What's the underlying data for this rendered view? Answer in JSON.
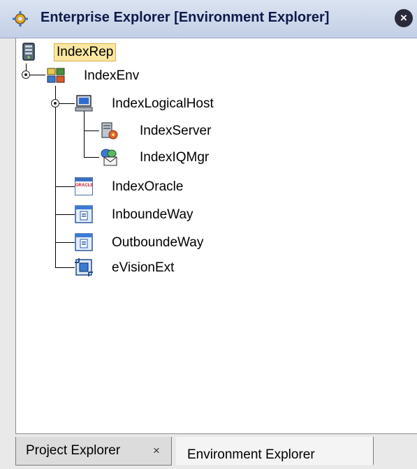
{
  "window": {
    "title": "Enterprise Explorer [Environment Explorer]",
    "icon": "explorer-gear-icon",
    "close_icon": "close-icon",
    "close_glyph": "×"
  },
  "tree": {
    "root": {
      "label": "IndexRep",
      "icon": "repository-icon",
      "selected": true
    },
    "environment": {
      "label": "IndexEnv",
      "icon": "environment-icon"
    },
    "logical_host": {
      "label": "IndexLogicalHost",
      "icon": "computer-host-icon"
    },
    "server": {
      "label": "IndexServer",
      "icon": "server-icon"
    },
    "iq_manager": {
      "label": "IndexIQMgr",
      "icon": "message-queue-icon"
    },
    "oracle": {
      "label": "IndexOracle",
      "icon": "oracle-icon",
      "icon_text": "ORACLE"
    },
    "inbound": {
      "label": "InboundeWay",
      "icon": "eway-icon"
    },
    "outbound": {
      "label": "OutboundeWay",
      "icon": "eway-icon"
    },
    "evision": {
      "label": "eVisionExt",
      "icon": "evision-icon"
    }
  },
  "tabs": [
    {
      "label": "Project Explorer",
      "close_glyph": "×",
      "active": false
    },
    {
      "label": "Environment Explorer",
      "active": true
    }
  ]
}
